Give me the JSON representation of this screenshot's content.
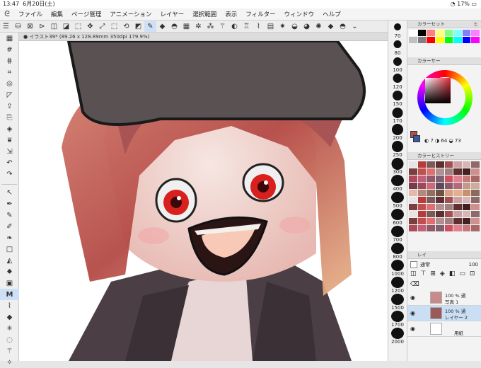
{
  "status": {
    "time": "13:47",
    "date": "6月20日(土)",
    "battery": "17%"
  },
  "menu": {
    "items": [
      "ファイル",
      "編集",
      "ページ管理",
      "アニメーション",
      "レイヤー",
      "選択範囲",
      "表示",
      "フィルター",
      "ウィンドウ",
      "ヘルプ"
    ]
  },
  "canvas_tab": {
    "title": "イラスト39* (89.26 x 128.89mm 350dpi 179.9%)"
  },
  "brush_sizes": [
    "70",
    "80",
    "100",
    "120",
    "150",
    "170",
    "200",
    "250",
    "300",
    "400",
    "500",
    "600",
    "700",
    "800",
    "1000",
    "1200",
    "1500",
    "1700",
    "2000"
  ],
  "panels": {
    "color_set": {
      "title": "カラーセット",
      "tab2": "ヒ"
    },
    "color_wheel": {
      "title": "カラーサー",
      "values": [
        "7",
        "64",
        "73"
      ]
    },
    "color_history": {
      "title": "カラーヒストリー"
    },
    "layer": {
      "title": "レイ",
      "blend": "通常",
      "opacity": "100"
    }
  },
  "layers": [
    {
      "opacity": "100 %",
      "mode": "通",
      "name": "写真 1",
      "selected": false
    },
    {
      "opacity": "100 %",
      "mode": "通",
      "name": "レイヤー 2",
      "selected": true
    },
    {
      "opacity": "",
      "mode": "",
      "name": "用紙",
      "selected": false
    }
  ],
  "colors": {
    "accent": "#3a7bd5",
    "history": [
      "#e8e4e4",
      "#b83a3a",
      "#7d5a5a",
      "#5c3030",
      "#a05050",
      "#caa0a0",
      "#d8b6b6",
      "#8c6a6a",
      "#7a4040",
      "#c05050",
      "#e07070",
      "#b09090",
      "#a08080",
      "#603030",
      "#402020",
      "#d09090",
      "#b04a5a",
      "#c0607a",
      "#905a6a",
      "#806070",
      "#d05060",
      "#e08090",
      "#c87878",
      "#a86868",
      "#7a3a4a",
      "#9a4a5a",
      "#cc6a7a",
      "#5a4a5a",
      "#8a5a6a",
      "#b06a7a",
      "#c09a8a",
      "#d0aa9a",
      "#e0baaa",
      "#b08a7a",
      "#907060",
      "#705040",
      "#d4a080",
      "#e0b090",
      "#c89070",
      "#8a6a5a"
    ],
    "set": [
      "#ffffff",
      "#000000",
      "#ff8080",
      "#ffff80",
      "#80ff80",
      "#80ffff",
      "#8080ff",
      "#ff80ff",
      "#c0c0c0",
      "#808080",
      "#ff0000",
      "#ffff00",
      "#00ff00",
      "#00ffff",
      "#0000ff",
      "#ff00ff"
    ]
  }
}
